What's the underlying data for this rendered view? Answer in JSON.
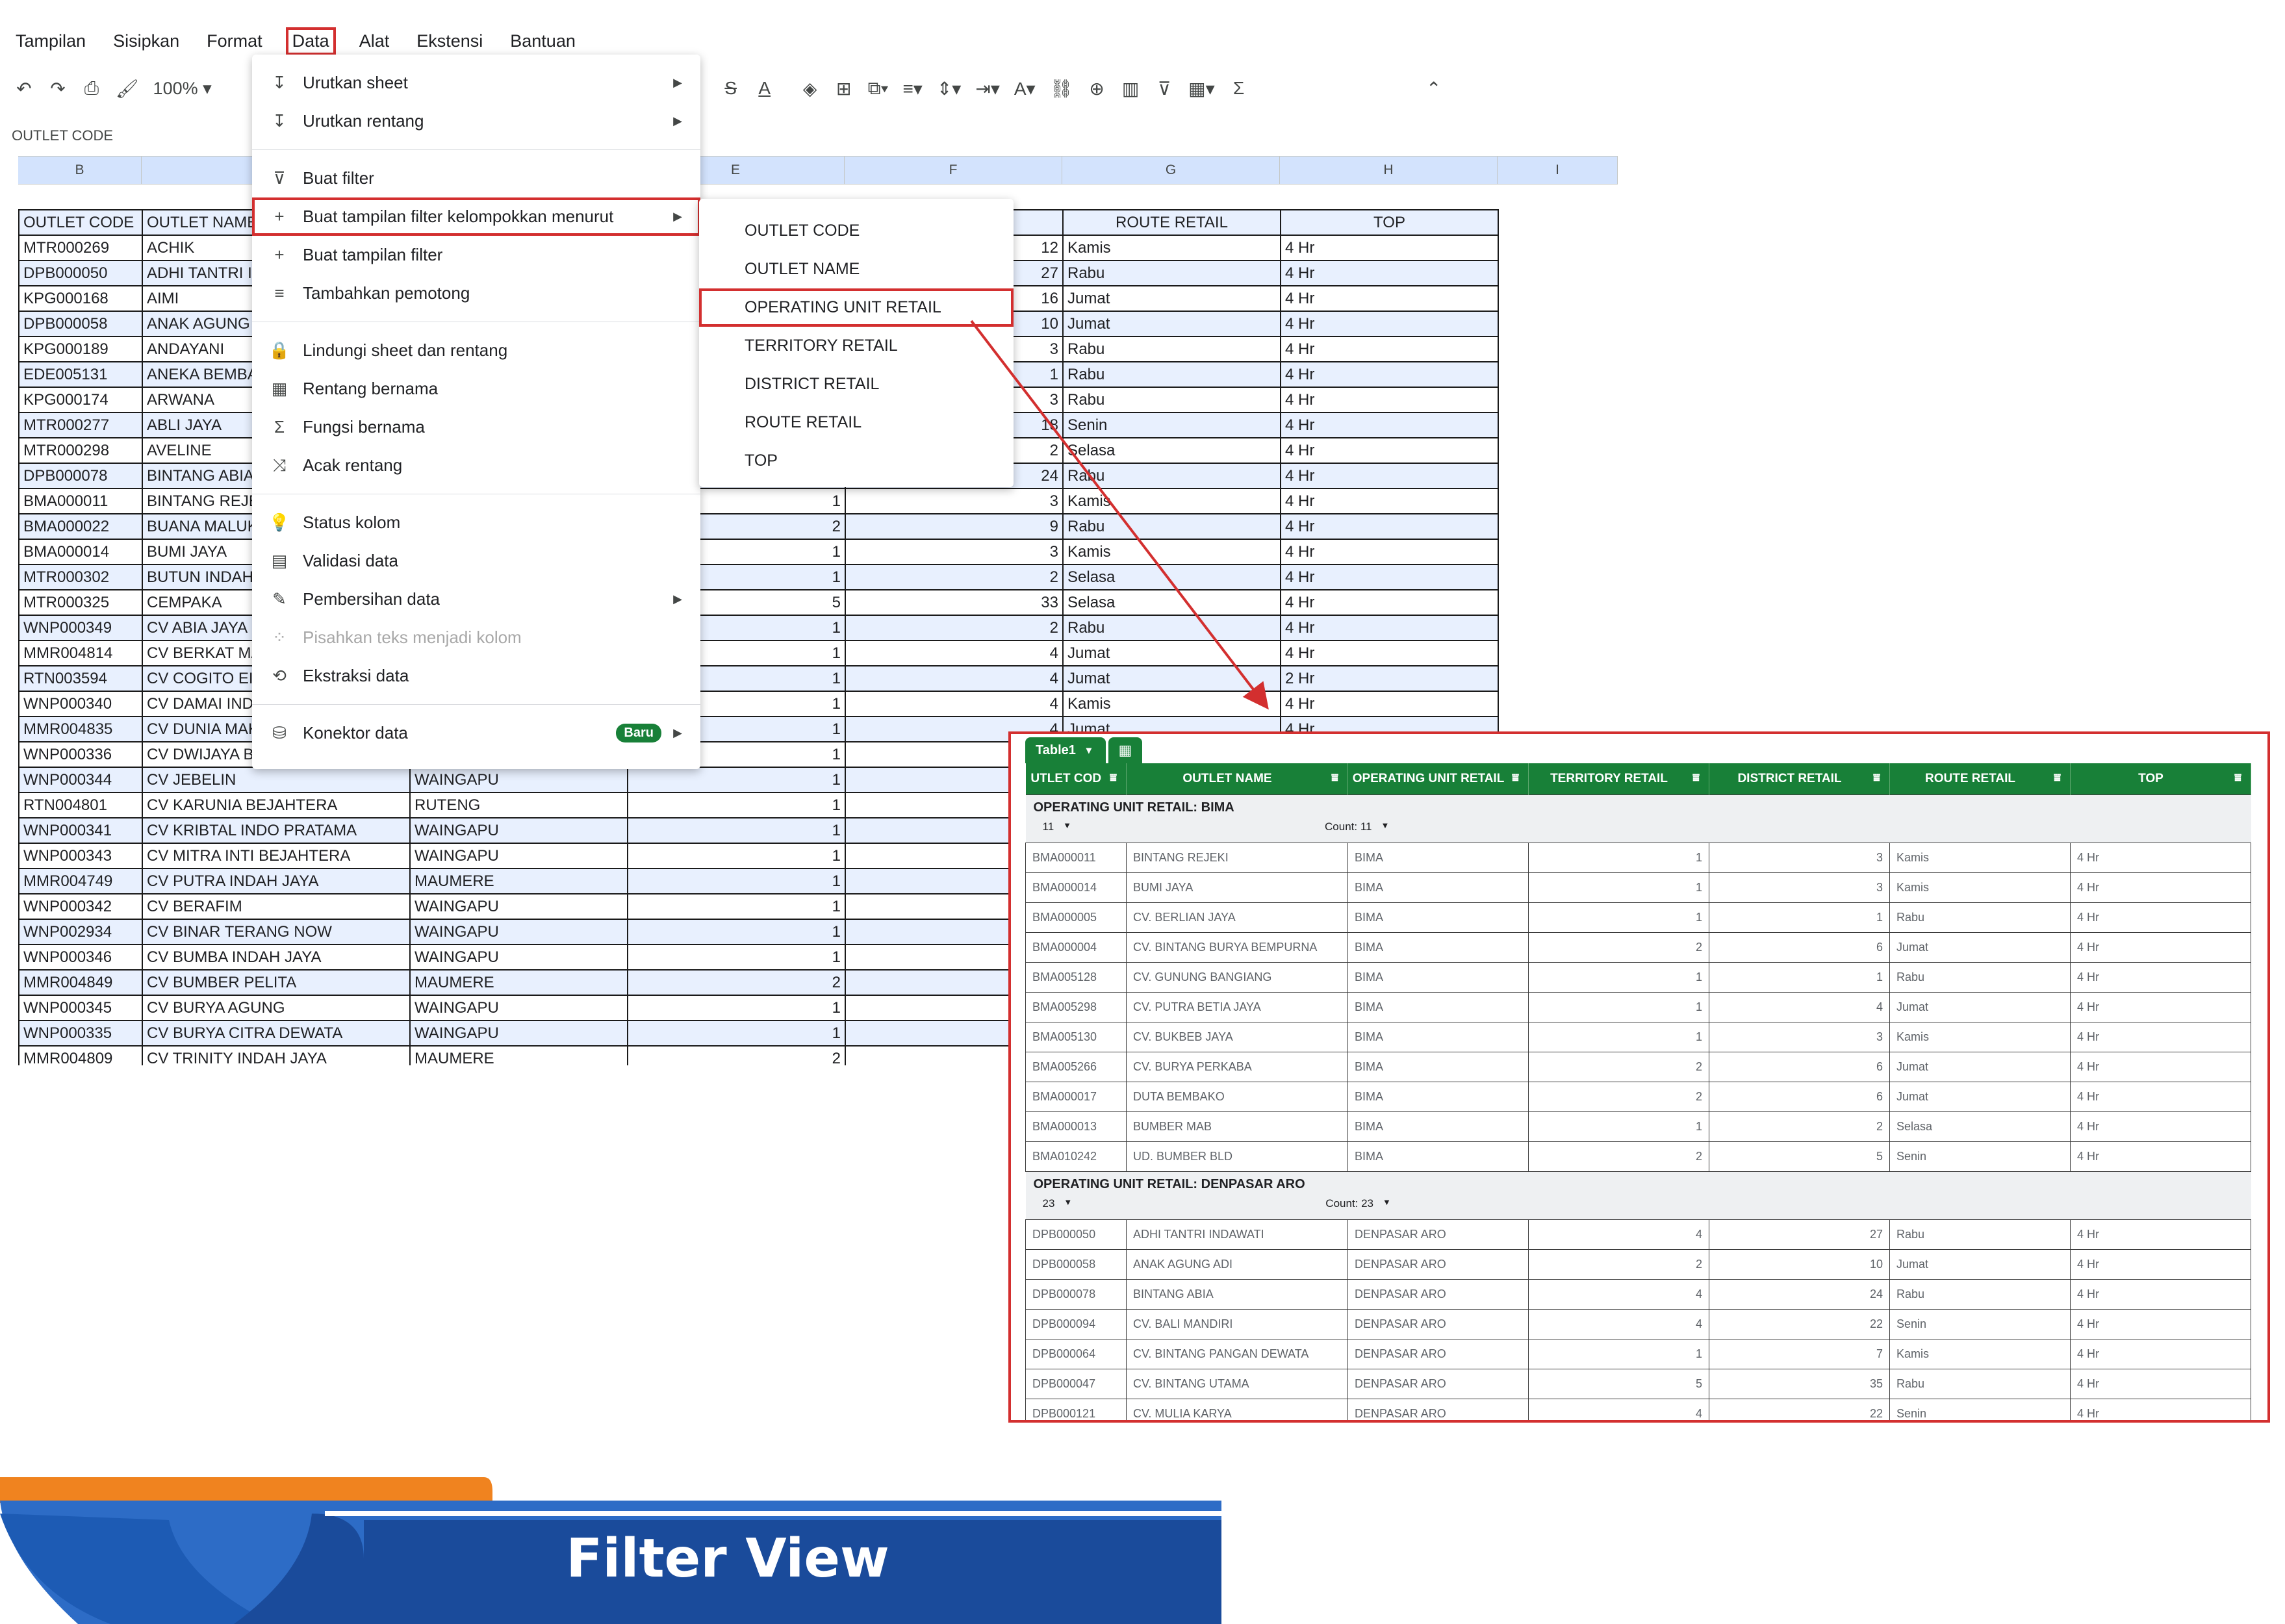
{
  "menubar": [
    "Tampilan",
    "Sisipkan",
    "Format",
    "Data",
    "Alat",
    "Ekstensi",
    "Bantuan"
  ],
  "toolbar": {
    "zoom": "100%"
  },
  "name_box": "OUTLET CODE",
  "column_headers": [
    "B",
    "",
    "",
    "E",
    "F",
    "G",
    "H",
    "I"
  ],
  "sheet": {
    "header": [
      "OUTLET CODE",
      "OUTLET NAME",
      "",
      "",
      "",
      "ROUTE RETAIL",
      "TOP"
    ],
    "rows": [
      [
        "MTR000269",
        "ACHIK",
        "",
        "",
        "12",
        "Kamis",
        "4 Hr"
      ],
      [
        "DPB000050",
        "ADHI TANTRI INDAWATI",
        "",
        "",
        "27",
        "Rabu",
        "4 Hr"
      ],
      [
        "KPG000168",
        "AIMI",
        "",
        "",
        "16",
        "Jumat",
        "4 Hr"
      ],
      [
        "DPB000058",
        "ANAK AGUNG ADI",
        "",
        "",
        "10",
        "Jumat",
        "4 Hr"
      ],
      [
        "KPG000189",
        "ANDAYANI",
        "",
        "",
        "3",
        "Rabu",
        "4 Hr"
      ],
      [
        "EDE005131",
        "ANEKA BEMBA",
        "",
        "",
        "1",
        "Rabu",
        "4 Hr"
      ],
      [
        "KPG000174",
        "ARWANA",
        "",
        "",
        "3",
        "Rabu",
        "4 Hr"
      ],
      [
        "MTR000277",
        "ABLI JAYA",
        "",
        "",
        "18",
        "Senin",
        "4 Hr"
      ],
      [
        "MTR000298",
        "AVELINE",
        "",
        "",
        "2",
        "Selasa",
        "4 Hr"
      ],
      [
        "DPB000078",
        "BINTANG ABIA",
        "",
        "",
        "24",
        "Rabu",
        "4 Hr"
      ],
      [
        "BMA000011",
        "BINTANG REJEKI",
        "",
        "1",
        "3",
        "Kamis",
        "4 Hr"
      ],
      [
        "BMA000022",
        "BUANA MALUKU",
        "",
        "2",
        "9",
        "Rabu",
        "4 Hr"
      ],
      [
        "BMA000014",
        "BUMI JAYA",
        "",
        "1",
        "3",
        "Kamis",
        "4 Hr"
      ],
      [
        "MTR000302",
        "BUTUN INDAH",
        "",
        "1",
        "2",
        "Selasa",
        "4 Hr"
      ],
      [
        "MTR000325",
        "CEMPAKA",
        "",
        "5",
        "33",
        "Selasa",
        "4 Hr"
      ],
      [
        "WNP000349",
        "CV ABIA JAYA",
        "",
        "1",
        "2",
        "Rabu",
        "4 Hr"
      ],
      [
        "MMR004814",
        "CV BERKAT MAKMUR",
        "",
        "1",
        "4",
        "Jumat",
        "4 Hr"
      ],
      [
        "RTN003594",
        "CV COGITO EI",
        "",
        "1",
        "4",
        "Jumat",
        "2 Hr"
      ],
      [
        "WNP000340",
        "CV DAMAI INDAH",
        "",
        "1",
        "4",
        "Kamis",
        "4 Hr"
      ],
      [
        "MMR004835",
        "CV DUNIA MAKMUR",
        "",
        "1",
        "4",
        "Jumat",
        "4 Hr"
      ],
      [
        "WNP000336",
        "CV DWIJAYA BERSAMA",
        "",
        "1",
        "",
        "",
        ""
      ],
      [
        "WNP000344",
        "CV JEBELIN",
        "WAINGAPU",
        "1",
        "",
        "",
        ""
      ],
      [
        "RTN004801",
        "CV KARUNIA BEJAHTERA",
        "RUTENG",
        "1",
        "",
        "",
        ""
      ],
      [
        "WNP000341",
        "CV KRIBTAL INDO PRATAMA",
        "WAINGAPU",
        "1",
        "",
        "",
        ""
      ],
      [
        "WNP000343",
        "CV MITRA INTI BEJAHTERA",
        "WAINGAPU",
        "1",
        "",
        "",
        ""
      ],
      [
        "MMR004749",
        "CV PUTRA INDAH JAYA",
        "MAUMERE",
        "1",
        "",
        "",
        ""
      ],
      [
        "WNP000342",
        "CV BERAFIM",
        "WAINGAPU",
        "1",
        "",
        "",
        ""
      ],
      [
        "WNP002934",
        "CV BINAR TERANG NOW",
        "WAINGAPU",
        "1",
        "",
        "",
        ""
      ],
      [
        "WNP000346",
        "CV BUMBA INDAH JAYA",
        "WAINGAPU",
        "1",
        "",
        "",
        ""
      ],
      [
        "MMR004849",
        "CV BUMBER PELITA",
        "MAUMERE",
        "2",
        "",
        "",
        ""
      ],
      [
        "WNP000345",
        "CV BURYA AGUNG",
        "WAINGAPU",
        "1",
        "",
        "",
        ""
      ],
      [
        "WNP000335",
        "CV BURYA CITRA DEWATA",
        "WAINGAPU",
        "1",
        "",
        "",
        ""
      ],
      [
        "MMR004809",
        "CV TRINITY INDAH JAYA",
        "MAUMERE",
        "2",
        "",
        "",
        ""
      ]
    ]
  },
  "data_menu": [
    {
      "icon": "↧",
      "name": "sort-sheet",
      "label": "Urutkan sheet",
      "arrow": true
    },
    {
      "icon": "↧",
      "name": "sort-range",
      "label": "Urutkan rentang",
      "arrow": true
    },
    {
      "sep": true
    },
    {
      "icon": "⊽",
      "name": "create-filter",
      "label": "Buat filter"
    },
    {
      "icon": "+",
      "name": "group-filter-view",
      "label": "Buat tampilan filter kelompokkan menurut",
      "arrow": true,
      "highlight": true
    },
    {
      "icon": "+",
      "name": "create-filter-view",
      "label": "Buat tampilan filter"
    },
    {
      "icon": "≡",
      "name": "add-slicer",
      "label": "Tambahkan pemotong"
    },
    {
      "sep": true
    },
    {
      "icon": "🔒",
      "name": "protect-sheets",
      "label": "Lindungi sheet dan rentang"
    },
    {
      "icon": "▦",
      "name": "named-ranges",
      "label": "Rentang bernama"
    },
    {
      "icon": "Σ",
      "name": "named-functions",
      "label": "Fungsi bernama"
    },
    {
      "icon": "⤨",
      "name": "randomize-range",
      "label": "Acak rentang"
    },
    {
      "sep": true
    },
    {
      "icon": "💡",
      "name": "column-stats",
      "label": "Status kolom"
    },
    {
      "icon": "▤",
      "name": "data-validation",
      "label": "Validasi data"
    },
    {
      "icon": "✎",
      "name": "data-cleanup",
      "label": "Pembersihan data",
      "arrow": true
    },
    {
      "icon": "⁘",
      "name": "split-text",
      "label": "Pisahkan teks menjadi kolom",
      "disabled": true
    },
    {
      "icon": "⟲",
      "name": "data-extraction",
      "label": "Ekstraksi data"
    },
    {
      "sep": true
    },
    {
      "icon": "⛁",
      "name": "data-connectors",
      "label": "Konektor data",
      "arrow": true,
      "badge": "Baru"
    }
  ],
  "submenu": [
    {
      "label": "OUTLET CODE"
    },
    {
      "label": "OUTLET NAME"
    },
    {
      "label": "OPERATING UNIT RETAIL",
      "highlight": true
    },
    {
      "label": "TERRITORY RETAIL"
    },
    {
      "label": "DISTRICT RETAIL"
    },
    {
      "label": "ROUTE RETAIL"
    },
    {
      "label": "TOP"
    }
  ],
  "filter_view": {
    "table_name": "Table1",
    "columns": [
      "UTLET COD",
      "OUTLET NAME",
      "OPERATING UNIT RETAIL",
      "TERRITORY RETAIL",
      "DISTRICT RETAIL",
      "ROUTE RETAIL",
      "TOP"
    ],
    "groups": [
      {
        "title": "OPERATING UNIT RETAIL: BIMA",
        "sub": "11",
        "count": "Count: 11",
        "rows": [
          [
            "BMA000011",
            "BINTANG REJEKI",
            "BIMA",
            "1",
            "3",
            "Kamis",
            "4 Hr"
          ],
          [
            "BMA000014",
            "BUMI JAYA",
            "BIMA",
            "1",
            "3",
            "Kamis",
            "4 Hr"
          ],
          [
            "BMA000005",
            "CV. BERLIAN JAYA",
            "BIMA",
            "1",
            "1",
            "Rabu",
            "4 Hr"
          ],
          [
            "BMA000004",
            "CV. BINTANG BURYA BEMPURNA",
            "BIMA",
            "2",
            "6",
            "Jumat",
            "4 Hr"
          ],
          [
            "BMA005128",
            "CV. GUNUNG BANGIANG",
            "BIMA",
            "1",
            "1",
            "Rabu",
            "4 Hr"
          ],
          [
            "BMA005298",
            "CV. PUTRA BETIA JAYA",
            "BIMA",
            "1",
            "4",
            "Jumat",
            "4 Hr"
          ],
          [
            "BMA005130",
            "CV. BUKBEB JAYA",
            "BIMA",
            "1",
            "3",
            "Kamis",
            "4 Hr"
          ],
          [
            "BMA005266",
            "CV. BURYA PERKABA",
            "BIMA",
            "2",
            "6",
            "Jumat",
            "4 Hr"
          ],
          [
            "BMA000017",
            "DUTA BEMBAKO",
            "BIMA",
            "2",
            "6",
            "Jumat",
            "4 Hr"
          ],
          [
            "BMA000013",
            "BUMBER MAB",
            "BIMA",
            "1",
            "2",
            "Selasa",
            "4 Hr"
          ],
          [
            "BMA010242",
            "UD. BUMBER BLD",
            "BIMA",
            "2",
            "5",
            "Senin",
            "4 Hr"
          ]
        ]
      },
      {
        "title": "OPERATING UNIT RETAIL: DENPASAR ARO",
        "sub": "23",
        "count": "Count: 23",
        "rows": [
          [
            "DPB000050",
            "ADHI TANTRI INDAWATI",
            "DENPASAR ARO",
            "4",
            "27",
            "Rabu",
            "4 Hr"
          ],
          [
            "DPB000058",
            "ANAK AGUNG ADI",
            "DENPASAR ARO",
            "2",
            "10",
            "Jumat",
            "4 Hr"
          ],
          [
            "DPB000078",
            "BINTANG ABIA",
            "DENPASAR ARO",
            "4",
            "24",
            "Rabu",
            "4 Hr"
          ],
          [
            "DPB000094",
            "CV. BALI MANDIRI",
            "DENPASAR ARO",
            "4",
            "22",
            "Senin",
            "4 Hr"
          ],
          [
            "DPB000064",
            "CV. BINTANG PANGAN DEWATA",
            "DENPASAR ARO",
            "1",
            "7",
            "Kamis",
            "4 Hr"
          ],
          [
            "DPB000047",
            "CV. BINTANG UTAMA",
            "DENPASAR ARO",
            "5",
            "35",
            "Rabu",
            "4 Hr"
          ],
          [
            "DPB000121",
            "CV. MULIA KARYA",
            "DENPASAR ARO",
            "4",
            "22",
            "Senin",
            "4 Hr"
          ]
        ]
      }
    ]
  },
  "banner": {
    "title": "Filter View",
    "colors": {
      "orange": "#f0831f",
      "blue": "#1a4b9b",
      "light_blue": "#2d6cc6"
    }
  }
}
